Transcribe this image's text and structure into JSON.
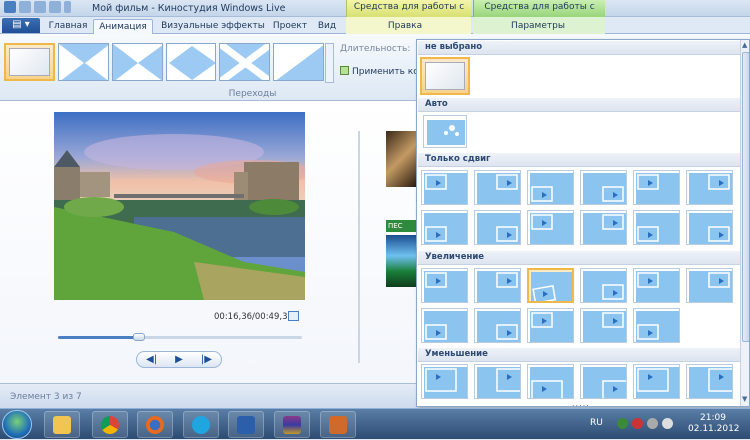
{
  "window": {
    "title": "Мой фильм - Киностудия Windows Live",
    "context_video": "Средства для работы с видео",
    "context_music": "Средства для работы с музыкой"
  },
  "tabs": [
    {
      "label": "Главная"
    },
    {
      "label": "Анимация"
    },
    {
      "label": "Визуальные эффекты"
    },
    {
      "label": "Проект"
    },
    {
      "label": "Вид"
    },
    {
      "label": "Правка"
    },
    {
      "label": "Параметры"
    }
  ],
  "ribbon": {
    "group_label": "Переходы",
    "duration_label": "Длительность:",
    "apply_label": "Применить ко в"
  },
  "player": {
    "timecode": "00:16,36/00:49,37",
    "progress": 0.33
  },
  "storyboard": {
    "clip_label": "ПЕС"
  },
  "status": {
    "text": "Элемент 3 из 7"
  },
  "transitions_panel": {
    "sections": [
      {
        "label": "не выбрано"
      },
      {
        "label": "Авто"
      },
      {
        "label": "Только сдвиг"
      },
      {
        "label": "Увеличение"
      },
      {
        "label": "Уменьшение"
      }
    ],
    "scroll_more": "....."
  },
  "tray": {
    "lang": "RU",
    "time": "21:09",
    "date": "02.11.2012"
  },
  "colors": {
    "accent": "#4a7fc1",
    "selection": "#f0b84a"
  }
}
